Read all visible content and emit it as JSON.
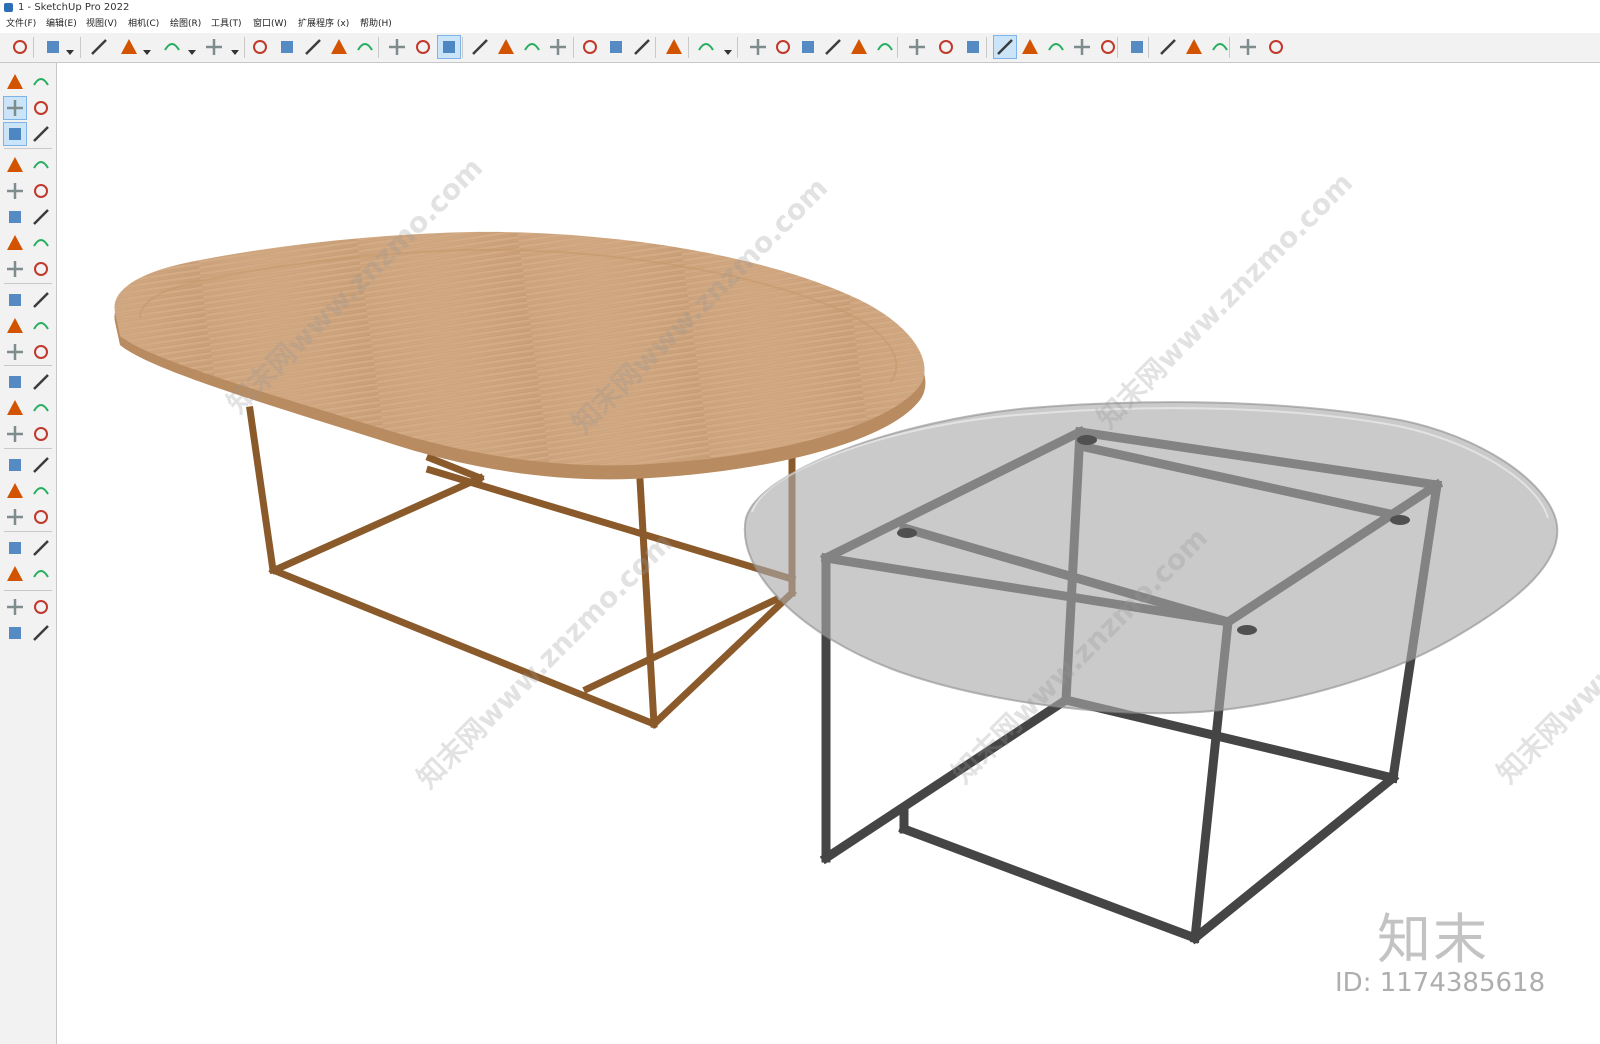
{
  "window": {
    "title": "1 - SketchUp Pro 2022"
  },
  "menu": [
    {
      "label": "文件(F)"
    },
    {
      "label": "编辑(E)"
    },
    {
      "label": "视图(V)"
    },
    {
      "label": "相机(C)"
    },
    {
      "label": "绘图(R)"
    },
    {
      "label": "工具(T)"
    },
    {
      "label": "窗口(W)"
    },
    {
      "label": "扩展程序 (x)"
    },
    {
      "label": "帮助(H)"
    }
  ],
  "toolbar": {
    "icons": [
      "zoom-icon",
      "select-icon",
      "eraser-icon",
      "pencil-icon",
      "arc-icon",
      "rectangle-icon",
      "push-pull-icon",
      "follow-me-icon",
      "move-icon",
      "rotate-icon",
      "scale-icon",
      "tape-measure-icon",
      "text-icon",
      "paint-bucket-icon",
      "orbit-icon",
      "pan-icon",
      "zoom-window-icon",
      "zoom-extents-icon",
      "warehouse-icon",
      "extension-warehouse-icon",
      "layout-icon",
      "styles-icon",
      "user-icon",
      "iso-view-icon",
      "top-view-icon",
      "front-view-icon",
      "right-view-icon",
      "back-view-icon",
      "left-view-icon",
      "bottom-view-icon",
      "solid-tools-icon",
      "sandbox-icon",
      "section-icon",
      "add-location-icon",
      "shadow-icon",
      "materials-icon",
      "texture-icon",
      "cloud-icon",
      "settings-icon",
      "components-icon",
      "info-icon",
      "cart-icon",
      "account-icon"
    ]
  },
  "left_toolbar": {
    "icons": [
      "select-icon",
      "make-component-icon",
      "paint-bucket-icon",
      "eraser-icon",
      "tag-icon",
      "paint-icon",
      "line-icon",
      "freehand-icon",
      "rectangle-icon",
      "rotated-rectangle-icon",
      "circle-icon",
      "polygon-icon",
      "arc-icon",
      "two-point-arc-icon",
      "three-point-arc-icon",
      "pie-icon",
      "move-icon",
      "push-pull-icon",
      "rotate-icon",
      "follow-me-icon",
      "scale-icon",
      "offset-icon",
      "tape-measure-icon",
      "dimension-icon",
      "protractor-icon",
      "text-icon",
      "axes-icon",
      "3d-text-icon",
      "orbit-icon",
      "pan-icon",
      "zoom-icon",
      "zoom-window-icon",
      "zoom-extents-icon",
      "previous-view-icon",
      "position-camera-icon",
      "look-around-icon",
      "walk-icon",
      "section-plane-icon",
      "warehouse-icon",
      "extension-icon",
      "layout-icon",
      "styles-icon"
    ]
  },
  "viewport": {
    "watermark_text": "知末网www.znzmo.com",
    "brand": "知末",
    "image_id": "ID: 1174385618"
  },
  "colors": {
    "wood_top": "#c79a6b",
    "wood_frame": "#8b5a2b",
    "glass": "#c4c4c4",
    "metal_frame": "#444444",
    "accent": "#2d6fb5"
  }
}
